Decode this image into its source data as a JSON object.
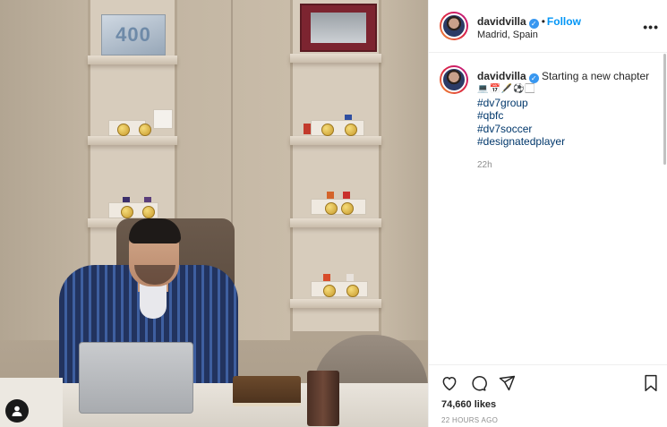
{
  "post": {
    "username": "davidvilla",
    "verified_mark": "✓",
    "follow_label": "Follow",
    "location": "Madrid, Spain",
    "more_label": "•••",
    "caption_text": "Starting a new chapter",
    "caption_emojis": "💻📅🖋️⚽🏻",
    "hashtags": [
      "#dv7group",
      "#qbfc",
      "#dv7soccer",
      "#designatedplayer"
    ],
    "time_ago": "22h",
    "likes": "74,660 likes",
    "posted_ago": "22 HOURS AGO"
  },
  "photo": {
    "trophy_text": "400"
  },
  "icons": {
    "like": "heart-icon",
    "comment": "comment-icon",
    "share": "share-icon",
    "save": "bookmark-icon",
    "tag": "user-tag-icon",
    "more": "more-options-icon",
    "verified": "verified-badge-icon"
  },
  "colors": {
    "link": "#0095f6",
    "hashtag": "#00376b",
    "verified": "#3897f0",
    "muted": "#8e8e8e"
  }
}
